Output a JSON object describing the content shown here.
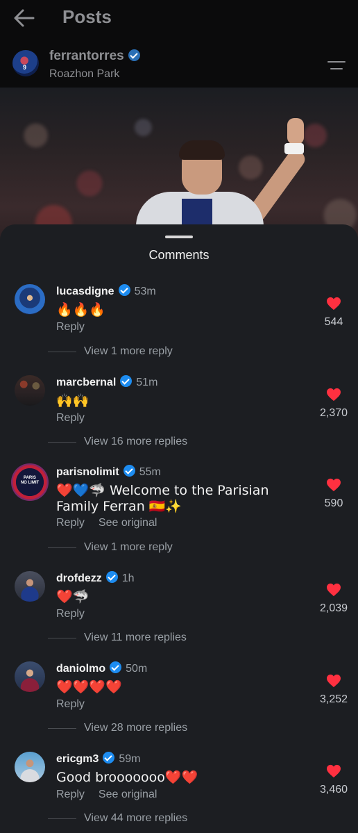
{
  "header": {
    "title": "Posts"
  },
  "post": {
    "username": "ferrantorres",
    "location": "Roazhon Park",
    "avatar_number": "9"
  },
  "sheet": {
    "title": "Comments"
  },
  "colors": {
    "heart": "#ff3040",
    "verified": "#1d8cf0",
    "sheet_bg": "#1c1e22"
  },
  "comments": [
    {
      "username": "lucasdigne",
      "time": "53m",
      "text": "🔥🔥🔥",
      "reply": "Reply",
      "likes": "544",
      "view_replies": "View 1 more reply"
    },
    {
      "username": "marcbernal",
      "time": "51m",
      "text": "🙌🙌",
      "reply": "Reply",
      "likes": "2,370",
      "view_replies": "View 16 more replies"
    },
    {
      "username": "parisnolimit",
      "time": "55m",
      "text": "❤️💙🦈 Welcome to the Parisian Family Ferran 🇪🇸✨",
      "reply": "Reply",
      "see_original": "See original",
      "likes": "590",
      "view_replies": "View 1 more reply",
      "avatar_text": "PARIS NO LIMIT"
    },
    {
      "username": "drofdezz",
      "time": "1h",
      "text": "❤️🦈",
      "reply": "Reply",
      "likes": "2,039",
      "view_replies": "View 11 more replies"
    },
    {
      "username": "daniolmo",
      "time": "50m",
      "text": "❤️❤️❤️❤️",
      "reply": "Reply",
      "likes": "3,252",
      "view_replies": "View 28 more replies"
    },
    {
      "username": "ericgm3",
      "time": "59m",
      "text": "Good brooooooo❤️❤️",
      "reply": "Reply",
      "see_original": "See original",
      "likes": "3,460",
      "view_replies": "View 44 more replies"
    }
  ]
}
